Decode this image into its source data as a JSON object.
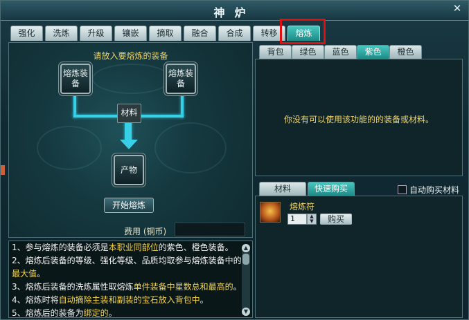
{
  "window": {
    "title": "神炉",
    "close": "✕"
  },
  "main_tabs": [
    "强化",
    "洗炼",
    "升级",
    "镶嵌",
    "摘取",
    "融合",
    "合成",
    "转移",
    "熔炼"
  ],
  "active_main_tab": "熔炼",
  "forge": {
    "hint": "请放入要熔炼的装备",
    "slot_left": "熔炼装备",
    "slot_right": "熔炼装备",
    "material_label": "材料",
    "product_label": "产物",
    "start_button": "开始熔炼",
    "fee_label": "费用 (铜币)",
    "fee_value": ""
  },
  "description": {
    "lines": [
      [
        "1、参与熔炼的装备必须是",
        "本职业同部位",
        "的紫色、橙色装备。"
      ],
      [
        "2、熔炼后装备的等级、强化等级、品质均取参与熔炼装备中的",
        "",
        ""
      ],
      [
        "",
        "最大值",
        "。"
      ],
      [
        "3、熔炼后装备的洗炼属性取熔炼",
        "单件装备中星数总和最高的",
        "。"
      ],
      [
        "4、熔炼时将",
        "自动摘除主装和副装的宝石放入背包中",
        "。"
      ],
      [
        "5、熔炼后的装备为",
        "绑定的",
        "。"
      ]
    ]
  },
  "bag_tabs": [
    "背包",
    "绿色",
    "蓝色",
    "紫色",
    "橙色"
  ],
  "active_bag_tab": "紫色",
  "bag_empty_message": "你没有可以使用该功能的的装备或材料。",
  "buy_tabs": [
    "材料",
    "快速购买"
  ],
  "active_buy_tab": "快速购买",
  "auto_buy_label": "自动购买材料",
  "auto_buy_checked": false,
  "shop_item": {
    "name": "熔炼符",
    "quantity": "1",
    "buy_button": "购买",
    "icon": "scroll-icon"
  },
  "colors": {
    "accent": "#37d0e6",
    "highlight_text": "#f5d44e",
    "active_tab": "#1e8a86",
    "callout": "#e01010"
  }
}
